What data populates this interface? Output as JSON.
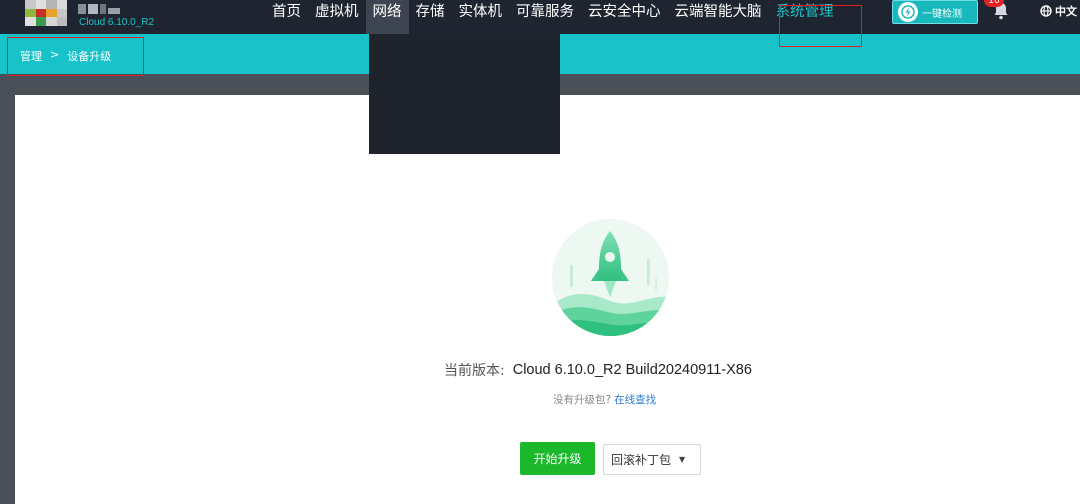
{
  "header": {
    "brand_version": "Cloud 6.10.0_R2",
    "nav": [
      {
        "label": "首页"
      },
      {
        "label": "虚拟机"
      },
      {
        "label": "网络"
      },
      {
        "label": "存储"
      },
      {
        "label": "实体机"
      },
      {
        "label": "可靠服务"
      },
      {
        "label": "云安全中心"
      },
      {
        "label": "云端智能大脑"
      },
      {
        "label": "系统管理"
      }
    ],
    "quick_check_label": "一键检测",
    "notification_count": "10",
    "language": "中文"
  },
  "breadcrumb": {
    "items": [
      "管理",
      ">",
      "设备升级"
    ]
  },
  "main": {
    "current_version_label": "当前版本:",
    "current_version_value": "Cloud 6.10.0_R2 Build20240911-X86",
    "no_package_text": "没有升级包?",
    "online_search_link": "在线查找",
    "upgrade_button": "开始升级",
    "rollback_button": "回滚补丁包"
  },
  "colors": {
    "accent_teal": "#17c2c8",
    "topbar": "#1f2530",
    "primary_green": "#1ab82a",
    "annotation_red": "#e02020"
  },
  "icons": [
    "logo-icon",
    "lightning-icon",
    "bell-icon",
    "globe-icon",
    "rocket-illustration",
    "caret-down-icon"
  ]
}
